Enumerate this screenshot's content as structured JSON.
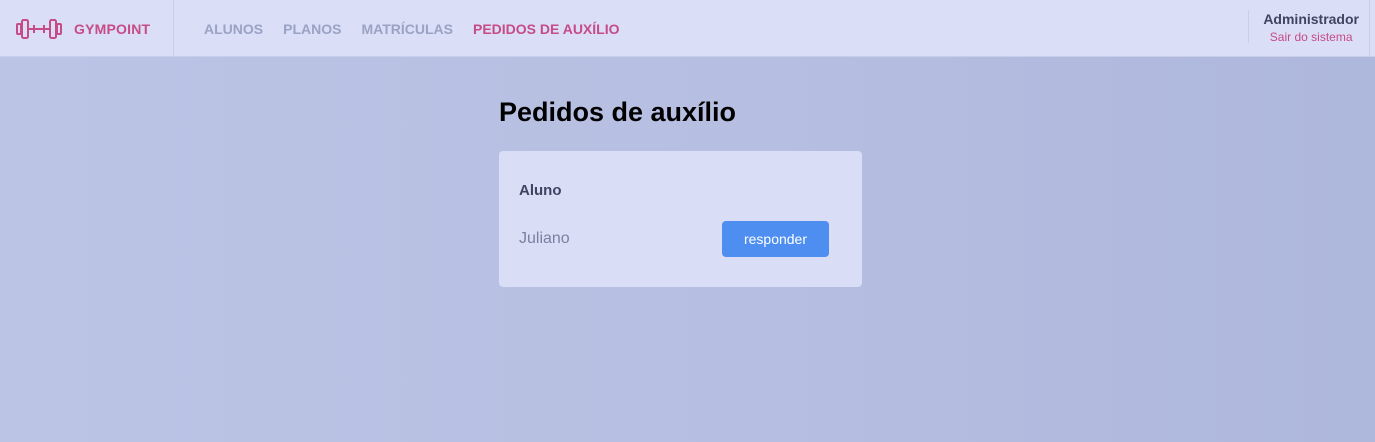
{
  "header": {
    "brand": {
      "name": "GYMPOINT",
      "icon": "dumbbell-icon"
    },
    "nav": [
      {
        "label": "ALUNOS",
        "active": false
      },
      {
        "label": "PLANOS",
        "active": false
      },
      {
        "label": "MATRÍCULAS",
        "active": false
      },
      {
        "label": "PEDIDOS DE AUXÍLIO",
        "active": true
      }
    ],
    "user": {
      "name": "Administrador",
      "logout_label": "Sair do sistema"
    }
  },
  "main": {
    "title": "Pedidos de auxílio",
    "table": {
      "columns": [
        "Aluno"
      ],
      "rows": [
        {
          "student": "Juliano",
          "action_label": "responder"
        }
      ]
    }
  },
  "colors": {
    "accent": "#c64b88",
    "button": "#4d8ef0",
    "header_bg": "#dadef7",
    "card_bg": "#d9ddf6"
  }
}
